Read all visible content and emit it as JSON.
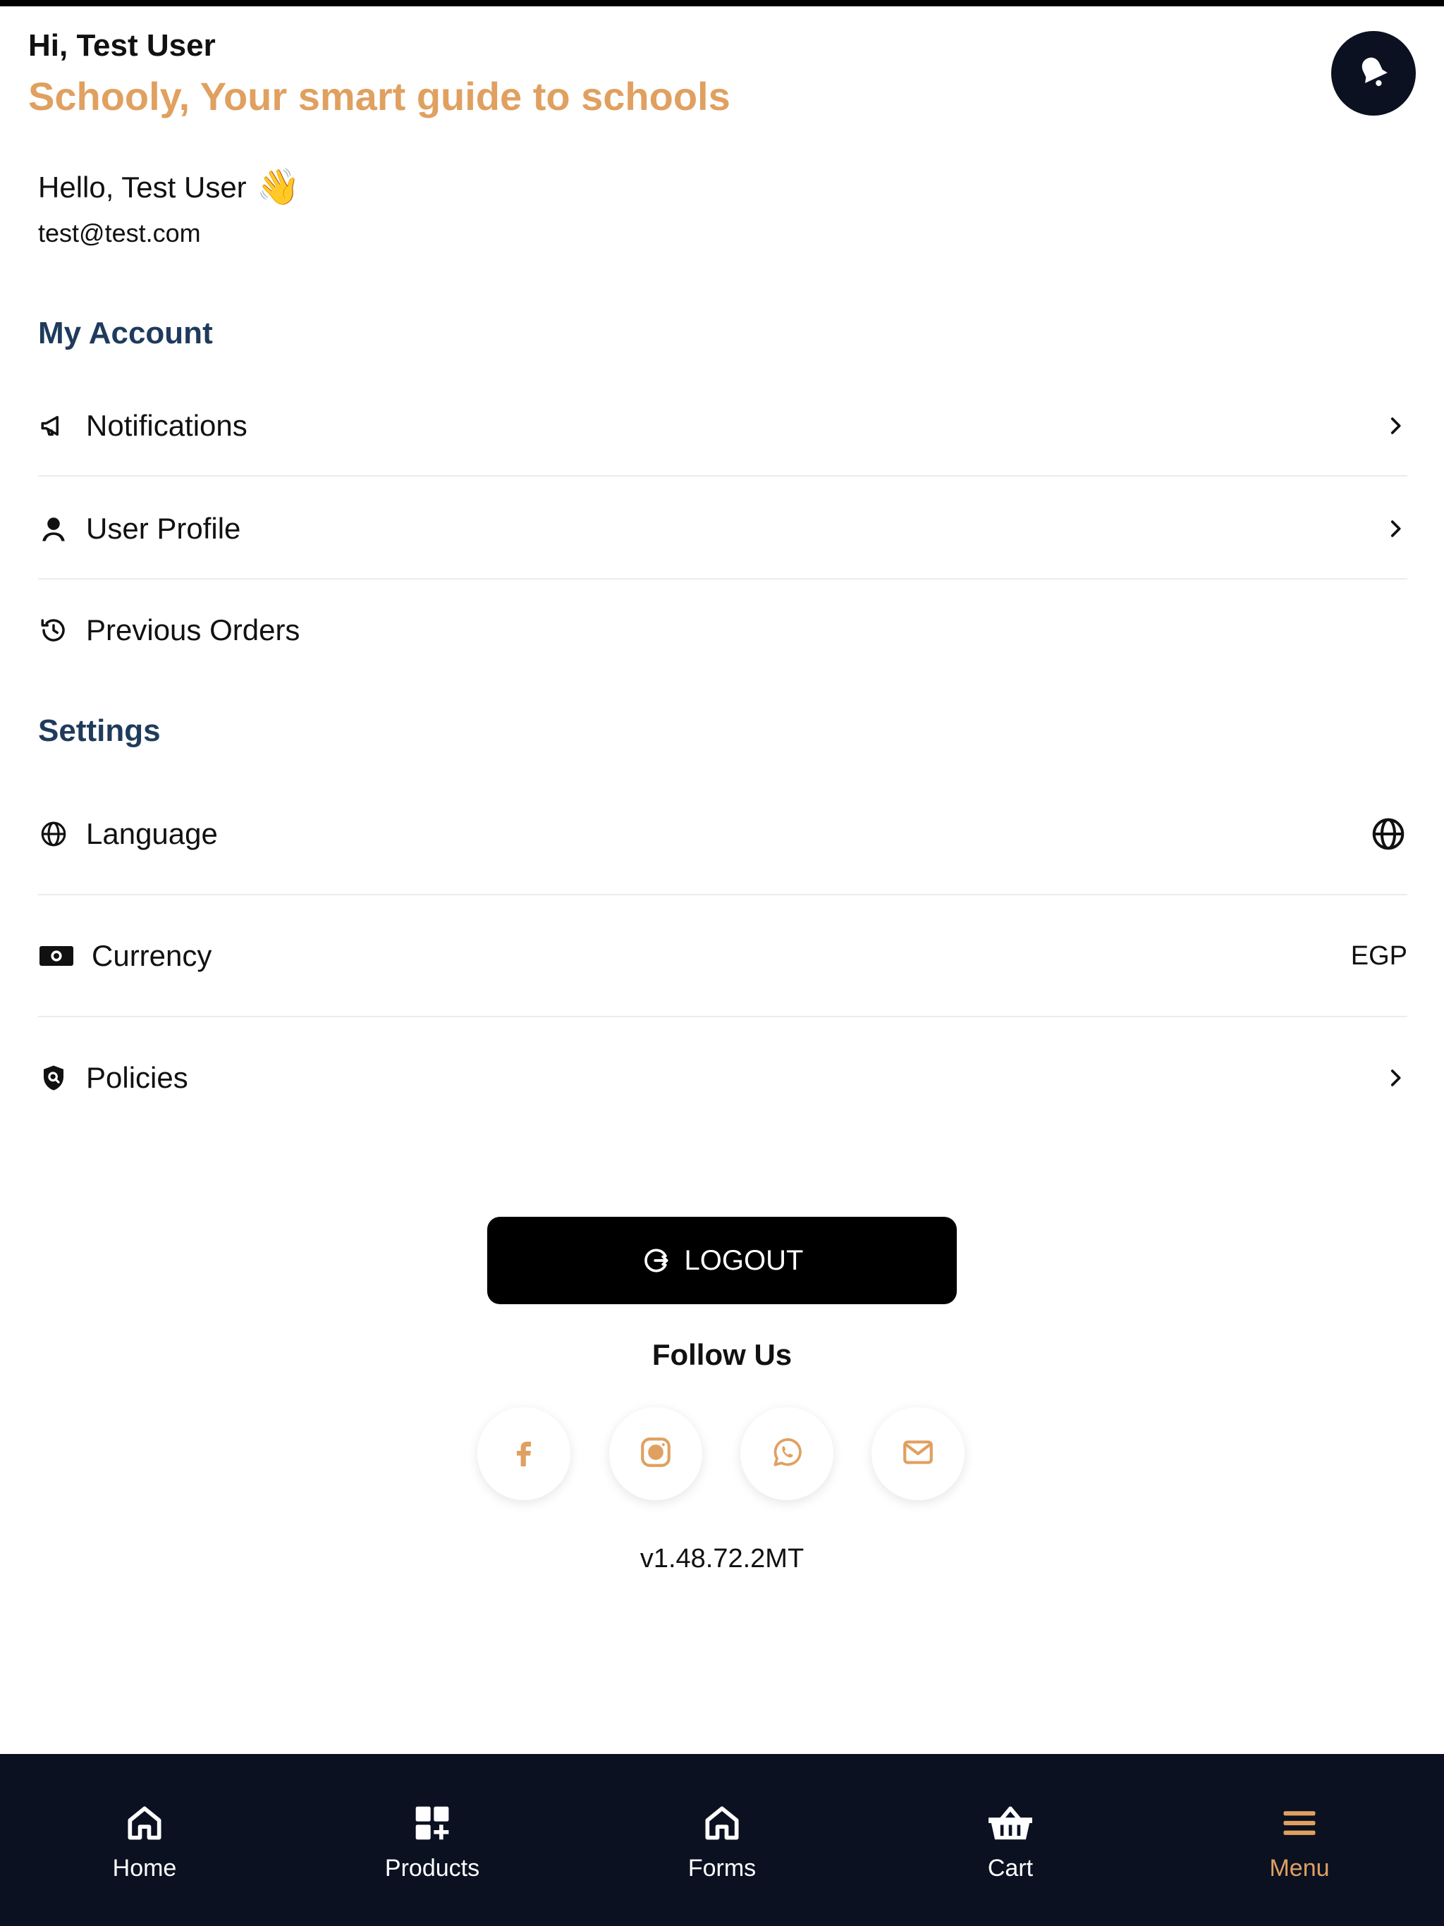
{
  "header": {
    "greeting": "Hi, Test User",
    "tagline": "Schooly, Your smart guide to schools",
    "bell_icon": "bell-icon"
  },
  "user": {
    "hello": "Hello, Test User",
    "wave_emoji": "👋",
    "email": "test@test.com"
  },
  "account": {
    "title": "My Account",
    "items": [
      {
        "label": "Notifications",
        "icon": "megaphone-icon",
        "right": "chevron-right-icon"
      },
      {
        "label": "User Profile",
        "icon": "user-icon",
        "right": "chevron-right-icon"
      },
      {
        "label": "Previous Orders",
        "icon": "history-icon",
        "right": ""
      }
    ]
  },
  "settings": {
    "title": "Settings",
    "items": [
      {
        "label": "Language",
        "icon": "globe-icon",
        "right": "globe-icon"
      },
      {
        "label": "Currency",
        "icon": "money-icon",
        "right_text": "EGP"
      },
      {
        "label": "Policies",
        "icon": "shield-icon",
        "right": "chevron-right-icon"
      }
    ]
  },
  "logout": {
    "label": "LOGOUT",
    "icon": "logout-icon"
  },
  "follow": {
    "title": "Follow Us",
    "socials": [
      "facebook-icon",
      "instagram-icon",
      "whatsapp-icon",
      "mail-icon"
    ]
  },
  "version": "v1.48.72.2MT",
  "bottom_nav": {
    "items": [
      {
        "label": "Home",
        "icon": "home-icon",
        "active": false
      },
      {
        "label": "Products",
        "icon": "grid-plus-icon",
        "active": false
      },
      {
        "label": "Forms",
        "icon": "home-icon",
        "active": false
      },
      {
        "label": "Cart",
        "icon": "basket-icon",
        "active": false
      },
      {
        "label": "Menu",
        "icon": "menu-icon",
        "active": true
      }
    ]
  },
  "colors": {
    "accent": "#E0A060",
    "heading": "#1F3B5C",
    "dark_navy": "#0b1121"
  }
}
